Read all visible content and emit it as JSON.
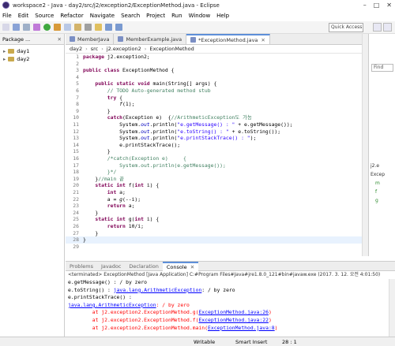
{
  "window": {
    "title": "workspace2 - Java - day2/src/j2/exception2/ExceptionMethod.java - Eclipse"
  },
  "menu": [
    "File",
    "Edit",
    "Source",
    "Refactor",
    "Navigate",
    "Search",
    "Project",
    "Run",
    "Window",
    "Help"
  ],
  "toolbar": {
    "quick_access": "Quick Access"
  },
  "package_explorer": {
    "tab": "Package ...",
    "items": [
      "day1",
      "day2"
    ]
  },
  "editor_tabs": [
    "MemberJava",
    "MemberExample.java",
    "*ExceptionMethod.java"
  ],
  "breadcrumb": [
    "day2",
    "src",
    "j2.exception2",
    "ExceptionMethod"
  ],
  "code": [
    {
      "n": "1",
      "html": "<span class=\"kw\">package</span> j2.exception2;"
    },
    {
      "n": "2",
      "html": ""
    },
    {
      "n": "3",
      "html": "<span class=\"kw\">public class</span> ExceptionMethod {"
    },
    {
      "n": "4",
      "html": ""
    },
    {
      "n": "5",
      "html": "    <span class=\"kw\">public static void</span> main(String[] args) {"
    },
    {
      "n": "6",
      "html": "        <span class=\"cm\">// TODO Auto-generated method stub</span>"
    },
    {
      "n": "7",
      "html": "        <span class=\"kw\">try</span> {"
    },
    {
      "n": "8",
      "html": "            <i>f</i>(1);"
    },
    {
      "n": "9",
      "html": "        }"
    },
    {
      "n": "10",
      "html": "        <span class=\"kw\">catch</span>(Exception e)  {<span class=\"cm\">//ArithmeticException도 가능</span>"
    },
    {
      "n": "11",
      "html": "            System.<span class=\"fd\">out</span>.println(<span class=\"st\">\"e.getMessage() : \"</span> + e.getMessage());"
    },
    {
      "n": "12",
      "html": "            System.<span class=\"fd\">out</span>.println(<span class=\"st\">\"e.toString() : \"</span> + e.toString());"
    },
    {
      "n": "13",
      "html": "            System.<span class=\"fd\">out</span>.println(<span class=\"st\">\"e.printStackTrace() : \"</span>);"
    },
    {
      "n": "14",
      "html": "            e.printStackTrace();"
    },
    {
      "n": "15",
      "html": "        }"
    },
    {
      "n": "16",
      "html": "        <span class=\"cm\">/*catch(Exception e)     {</span>"
    },
    {
      "n": "17",
      "html": "<span class=\"cm\">            System.out.println(e.getMessage());</span>"
    },
    {
      "n": "18",
      "html": "<span class=\"cm\">        }*/</span>"
    },
    {
      "n": "19",
      "html": "    }<span class=\"cm\">//main 끝</span>"
    },
    {
      "n": "20",
      "html": "    <span class=\"kw\">static int</span> f(<span class=\"kw\">int</span> i) {"
    },
    {
      "n": "21",
      "html": "        <span class=\"kw\">int</span> a;"
    },
    {
      "n": "22",
      "html": "        a = <i>g</i>(--i);"
    },
    {
      "n": "23",
      "html": "        <span class=\"kw\">return</span> a;"
    },
    {
      "n": "24",
      "html": "    }"
    },
    {
      "n": "25",
      "html": "    <span class=\"kw\">static int</span> g(<span class=\"kw\">int</span> i) {"
    },
    {
      "n": "26",
      "html": "        <span class=\"kw\">return</span> 10/i;"
    },
    {
      "n": "27",
      "html": "    }"
    },
    {
      "n": "28",
      "html": "}"
    },
    {
      "n": "29",
      "html": ""
    }
  ],
  "bottom_tabs": [
    "Problems",
    "Javadoc",
    "Declaration",
    "Console"
  ],
  "console_header": "<terminated> ExceptionMethod [Java Application] C:#Program Files#Java#jre1.8.0_121#bin#javaw.exe (2017. 3. 12. 오전 4:01:50)",
  "console": [
    {
      "cls": "",
      "html": "e.getMessage() : / by zero"
    },
    {
      "cls": "",
      "html": "e.toString() : <span class=\"lnk\">java.lang.ArithmeticException</span>: / by zero"
    },
    {
      "cls": "",
      "html": "e.printStackTrace() :"
    },
    {
      "cls": "err",
      "html": "<span class=\"lnk\">java.lang.ArithmeticException</span>: / by zero"
    },
    {
      "cls": "err",
      "html": "        at j2.exception2.ExceptionMethod.g(<span class=\"lnk\">ExceptionMethod.java:26</span>)"
    },
    {
      "cls": "err",
      "html": "        at j2.exception2.ExceptionMethod.f(<span class=\"lnk\">ExceptionMethod.java:22</span>)"
    },
    {
      "cls": "err",
      "html": "        at j2.exception2.ExceptionMethod.main(<span class=\"lnk\">ExceptionMethod.java:8</span>)"
    }
  ],
  "status": {
    "mode": "Writable",
    "insert": "Smart Insert",
    "position": "28 : 1"
  },
  "right_panel": {
    "find_label": "Find",
    "items": [
      "j2.e",
      "Excep",
      "m",
      "f",
      "g"
    ]
  }
}
